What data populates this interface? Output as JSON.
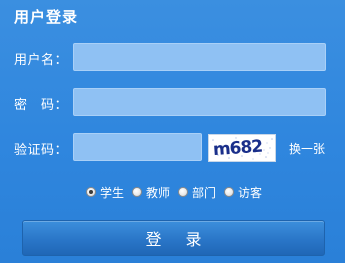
{
  "panel": {
    "title": "用户登录"
  },
  "form": {
    "username": {
      "label": "用户名：",
      "value": "",
      "placeholder": ""
    },
    "password": {
      "label": "密　码：",
      "value": "",
      "placeholder": ""
    },
    "captcha": {
      "label": "验证码：",
      "value": "",
      "placeholder": "",
      "image_text": "m682",
      "refresh_label": "换一张"
    }
  },
  "roles": {
    "selected": "学生",
    "options": [
      "学生",
      "教师",
      "部门",
      "访客"
    ]
  },
  "login_button": {
    "label": "登录"
  },
  "colors": {
    "background": "#2f86de",
    "input_fill": "#8fc1f3",
    "button": "#2a76c8",
    "captcha_text": "#1a2f8a"
  }
}
